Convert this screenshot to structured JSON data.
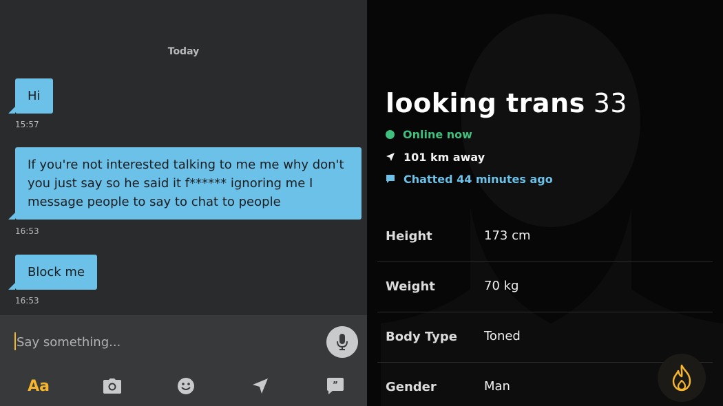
{
  "chat": {
    "date_separator": "Today",
    "messages": [
      {
        "text": "Hi",
        "time": "15:57"
      },
      {
        "text": "If you're not interested talking to me me why don't you just say so he said it f****** ignoring me I message people to say to chat to people",
        "time": "16:53"
      },
      {
        "text": "Block me",
        "time": "16:53"
      }
    ],
    "composer": {
      "placeholder": "Say something...",
      "value": ""
    },
    "toolbar": {
      "text_format_label": "Aa",
      "icons": [
        "camera-icon",
        "emoji-icon",
        "location-icon",
        "saved-phrases-icon"
      ]
    }
  },
  "profile": {
    "name": "looking trans",
    "age": "33",
    "online_status": "Online now",
    "distance": "101 km away",
    "last_chatted": "Chatted 44 minutes ago",
    "stats": [
      {
        "label": "Height",
        "value": "173 cm"
      },
      {
        "label": "Weight",
        "value": "70 kg"
      },
      {
        "label": "Body Type",
        "value": "Toned"
      },
      {
        "label": "Gender",
        "value": "Man"
      }
    ],
    "action_icon": "fire-icon"
  },
  "colors": {
    "accent": "#f5b62d",
    "bubble": "#6cc1e8",
    "online": "#3fc07e",
    "chat_bg": "#2a2b2d",
    "composer_bg": "#38393b",
    "profile_bg": "#070707"
  }
}
